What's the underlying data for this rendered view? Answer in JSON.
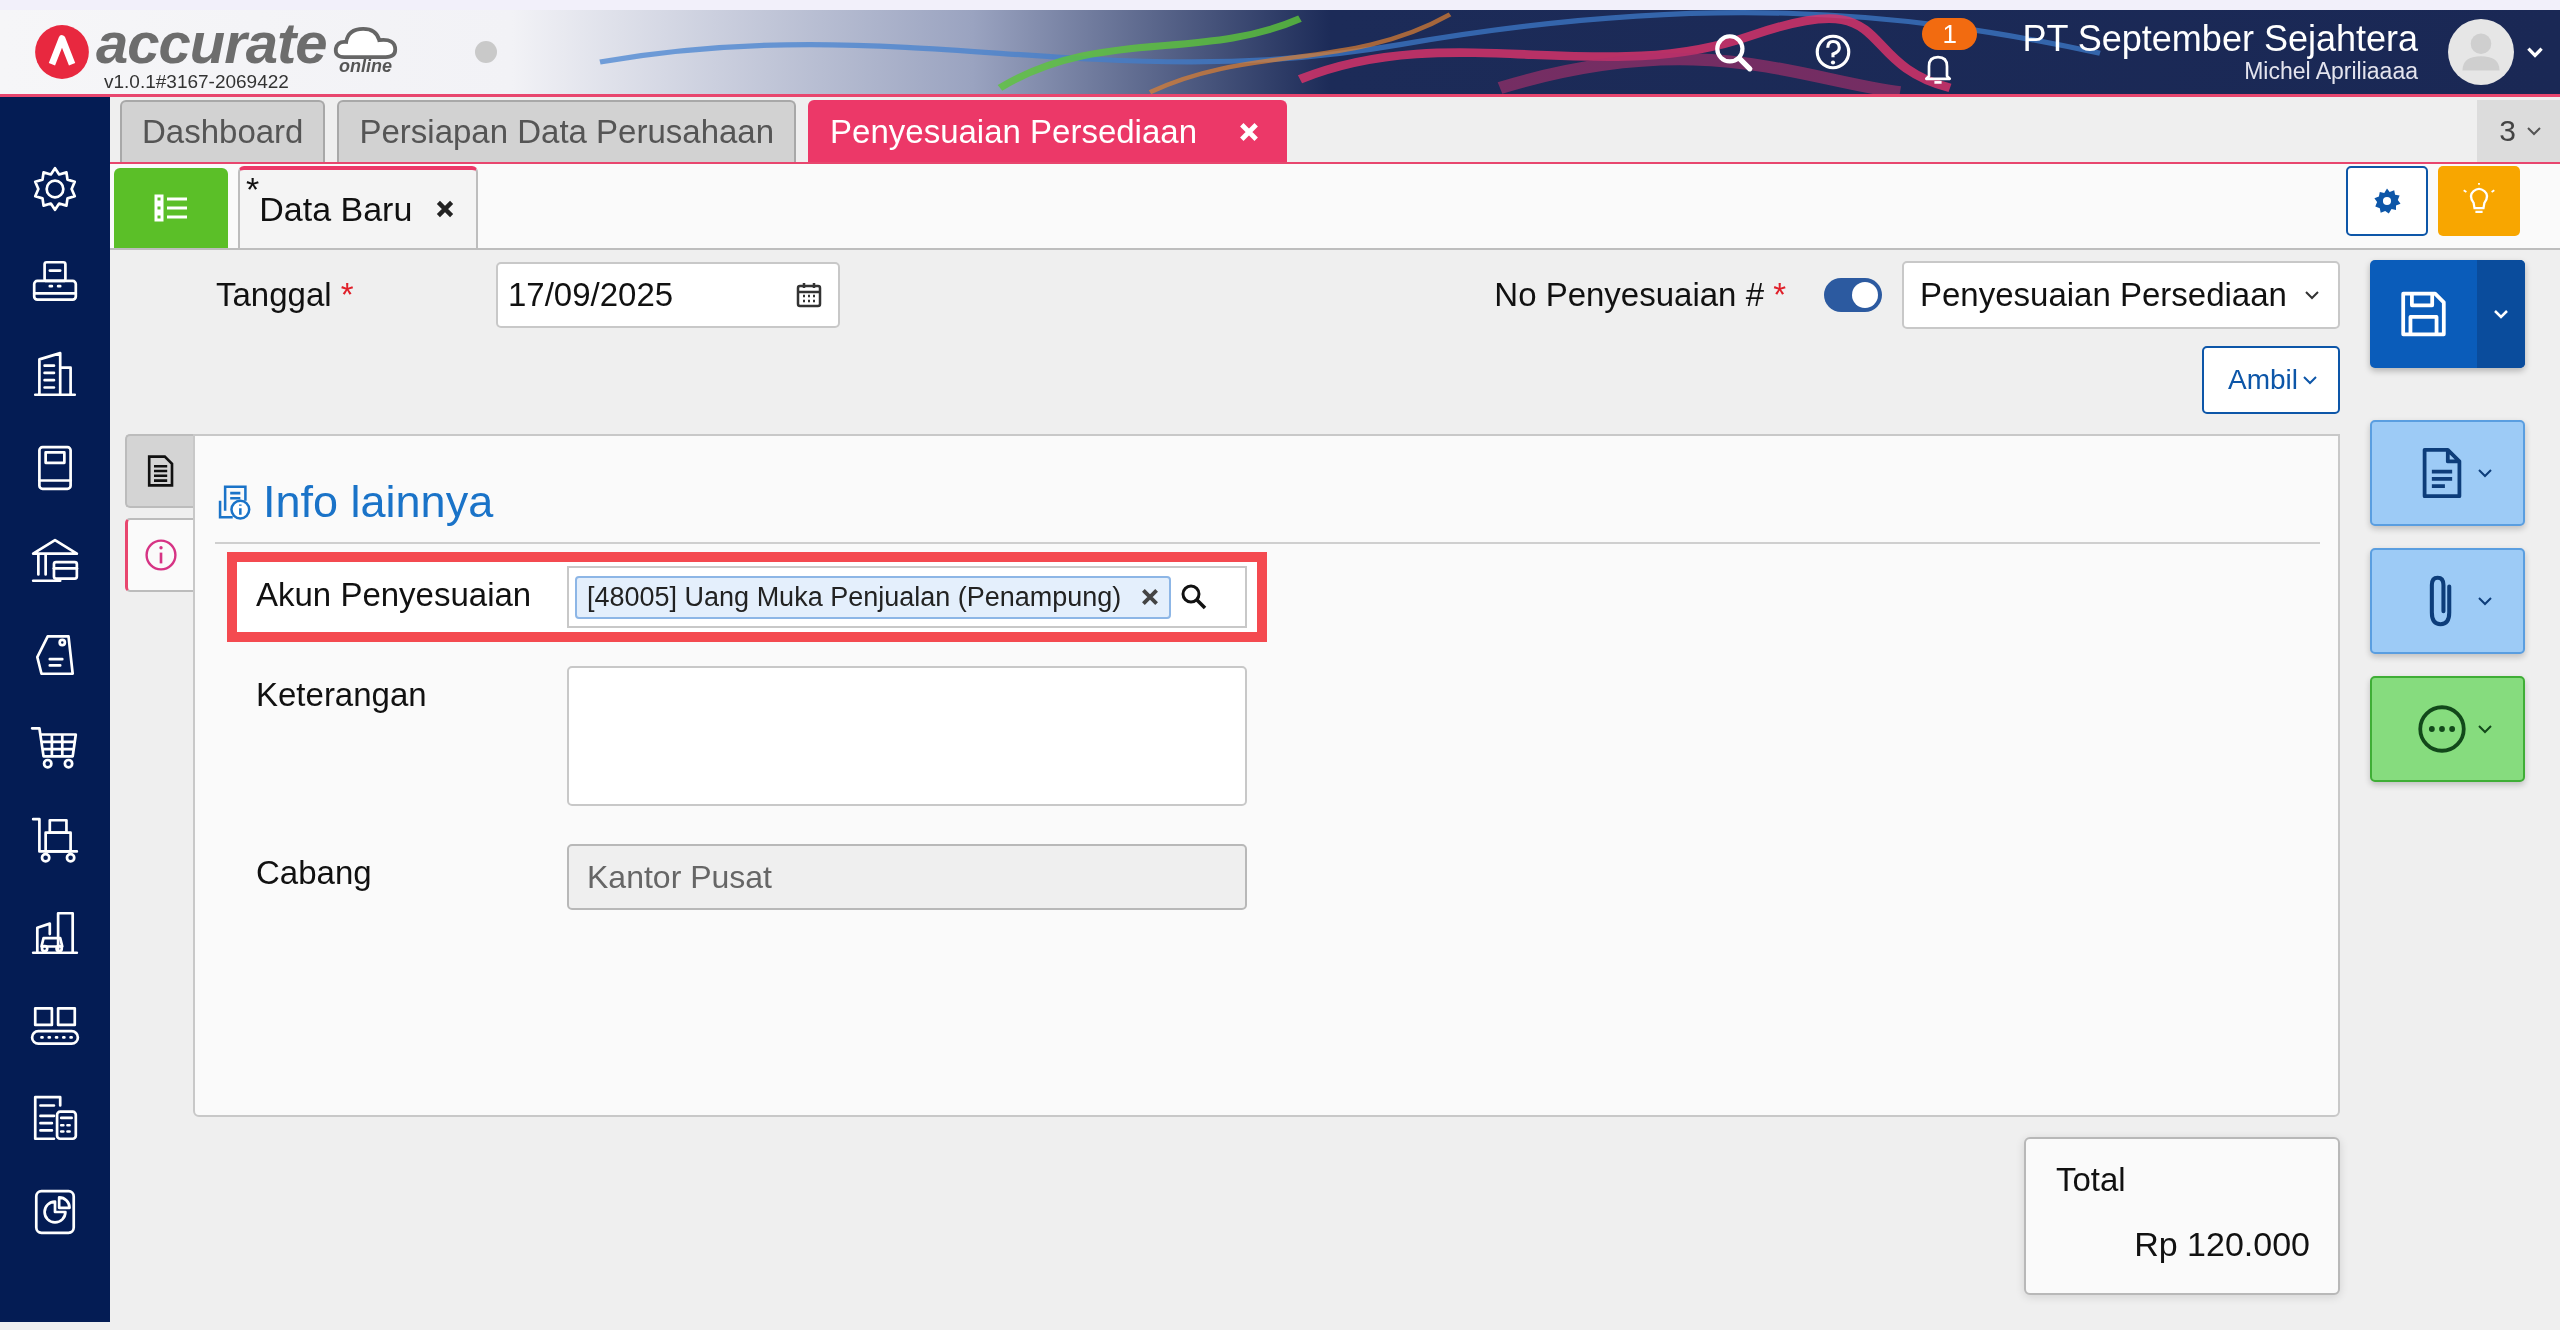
{
  "header": {
    "logo_text": "accurate",
    "logo_sub": "online",
    "version": "v1.0.1#3167-2069422",
    "notification_count": "1",
    "company": "PT September Sejahtera",
    "user": "Michel Apriliaaaa"
  },
  "tabs": [
    {
      "label": "Dashboard",
      "selected": false
    },
    {
      "label": "Persiapan Data Perusahaan",
      "selected": false
    },
    {
      "label": "Penyesuaian Persediaan",
      "selected": true
    }
  ],
  "tab_count": "3",
  "doc_tab": {
    "label": "Data Baru",
    "modified_mark": "*"
  },
  "form": {
    "date_label": "Tanggal",
    "date_required": "*",
    "date_value": "17/09/2025",
    "number_label": "No Penyesuaian #",
    "number_required": "*",
    "auto_number": true,
    "number_type": "Penyesuaian Persediaan",
    "fetch_button": "Ambil"
  },
  "side_tabs": [
    {
      "kind": "document",
      "selected": false
    },
    {
      "kind": "info",
      "selected": true
    }
  ],
  "section": {
    "title": "Info lainnya",
    "fields": [
      {
        "kind": "tag",
        "label": "Akun Penyesuaian",
        "value": "[48005] Uang Muka Penjualan (Penampung)",
        "highlighted": true
      },
      {
        "kind": "textarea",
        "label": "Keterangan",
        "highlighted": false
      },
      {
        "kind": "readonly",
        "label": "Cabang",
        "value": "Kantor Pusat",
        "highlighted": false
      }
    ]
  },
  "total": {
    "label": "Total",
    "value": "Rp 120.000"
  }
}
